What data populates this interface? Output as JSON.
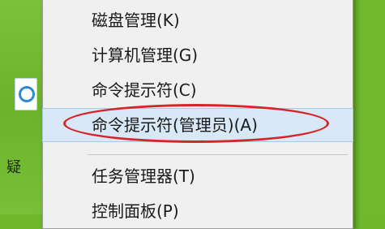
{
  "desktop": {
    "label": "疑",
    "icon": "shield-icon"
  },
  "context_menu": {
    "items": [
      {
        "label": "磁盘管理(K)"
      },
      {
        "label": "计算机管理(G)"
      },
      {
        "label": "命令提示符(C)"
      },
      {
        "label": "命令提示符(管理员)(A)",
        "highlighted": true
      },
      {
        "label": "任务管理器(T)"
      },
      {
        "label": "控制面板(P)"
      }
    ]
  },
  "colors": {
    "desktop": "#6fb82e",
    "menu_background": "#f0f0f0",
    "hover_background": "#d9e8f7",
    "annotation": "#d62427"
  }
}
